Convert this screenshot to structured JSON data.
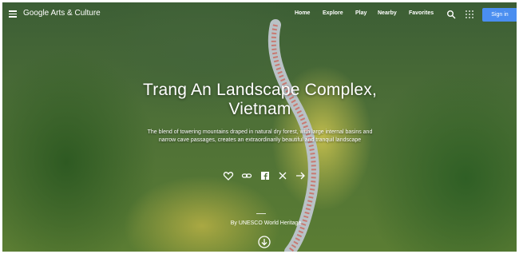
{
  "header": {
    "brand": "Google Arts & Culture",
    "nav": [
      "Home",
      "Explore",
      "Play",
      "Nearby",
      "Favorites"
    ],
    "sign_in": "Sign in"
  },
  "hero": {
    "title_line1": "Trang An Landscape Complex,",
    "title_line2": "Vietnam",
    "description_line1": "The blend of towering mountains draped in natural dry forest, with large internal basins and",
    "description_line2": "narrow cave passages, creates an extraordinarily beautiful and tranquil landscape",
    "credit": "By UNESCO World Heritage"
  },
  "icons": {
    "menu": "menu-icon",
    "search": "search-icon",
    "apps": "apps-icon",
    "favorite": "heart-icon",
    "link": "link-icon",
    "facebook": "facebook-icon",
    "twitter": "x-icon",
    "share": "share-icon",
    "down": "down-arrow-icon"
  },
  "colors": {
    "sign_in_bg": "#4a8ef0",
    "text": "#ffffff"
  }
}
